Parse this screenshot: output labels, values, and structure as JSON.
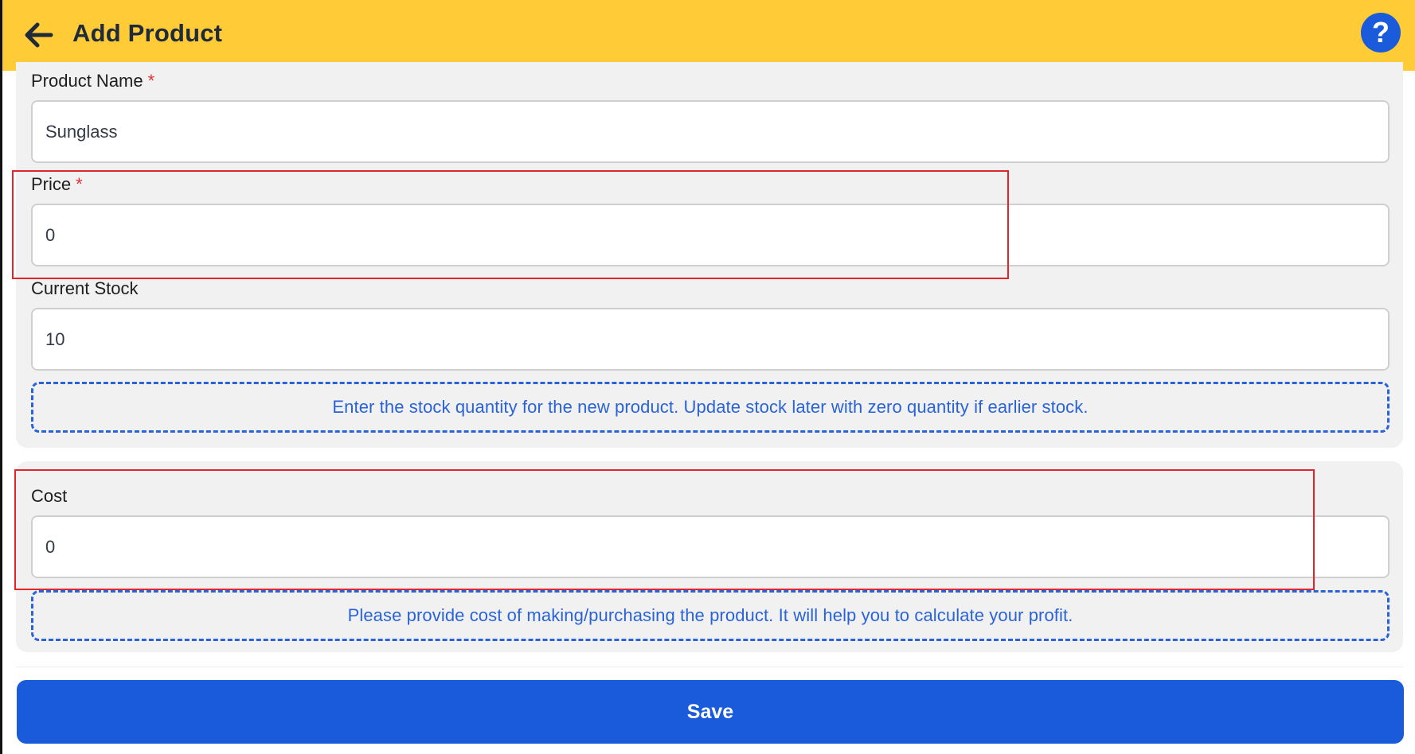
{
  "appbar": {
    "title": "Add Product",
    "back_icon": "arrow-left-icon",
    "help_icon": "question-circle-icon",
    "help_glyph": "?",
    "background": "#ffcb36"
  },
  "form": {
    "product_name": {
      "label": "Product Name",
      "required_mark": "*",
      "value": "Sunglass"
    },
    "price": {
      "label": "Price",
      "required_mark": "*",
      "value": "0"
    },
    "current_stock": {
      "label": "Current Stock",
      "value": "10",
      "hint": "Enter the stock quantity for the new product. Update stock later with zero quantity if earlier stock."
    },
    "cost": {
      "label": "Cost",
      "value": "0",
      "hint": "Please provide cost of making/purchasing the product. It will help you to calculate your profit."
    }
  },
  "actions": {
    "save_label": "Save"
  },
  "colors": {
    "primary": "#1a5bdc",
    "required": "#e1323a",
    "highlight": "#e3242b",
    "card": "#f1f1f1"
  }
}
